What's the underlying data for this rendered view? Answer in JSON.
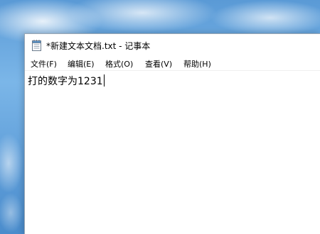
{
  "window": {
    "title": "*新建文本文档.txt - 记事本",
    "app_icon": "notepad-icon"
  },
  "menu": {
    "items": [
      {
        "label": "文件(F)"
      },
      {
        "label": "编辑(E)"
      },
      {
        "label": "格式(O)"
      },
      {
        "label": "查看(V)"
      },
      {
        "label": "帮助(H)"
      }
    ]
  },
  "editor": {
    "content": "打的数字为1231"
  },
  "colors": {
    "window_background": "#ffffff",
    "text": "#000000",
    "desktop_sky": "#5f9fd8"
  }
}
